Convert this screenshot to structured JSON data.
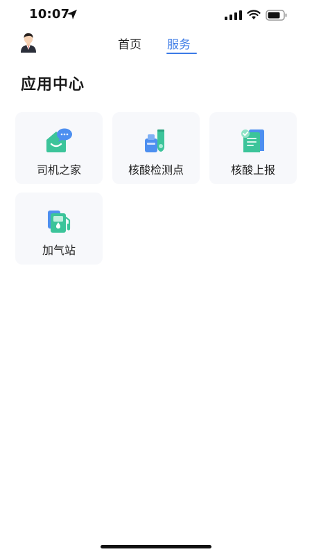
{
  "status_bar": {
    "time": "10:07",
    "icons": [
      "location-arrow-icon",
      "signal-icon",
      "wifi-icon",
      "battery-icon"
    ]
  },
  "header": {
    "avatar_icon": "person-avatar-icon",
    "tabs": [
      {
        "label": "首页",
        "active": false
      },
      {
        "label": "服务",
        "active": true
      }
    ]
  },
  "section": {
    "title": "应用中心"
  },
  "apps": [
    {
      "label": "司机之家",
      "icon": "driver-home-icon"
    },
    {
      "label": "核酸检测点",
      "icon": "test-lab-icon"
    },
    {
      "label": "核酸上报",
      "icon": "report-pass-icon"
    },
    {
      "label": "加气站",
      "icon": "gas-station-icon"
    }
  ],
  "colors": {
    "accent": "#3b7ae6",
    "card_bg": "#f7f8fb",
    "icon_green": "#3cc49a",
    "icon_blue": "#4d8ff0"
  }
}
